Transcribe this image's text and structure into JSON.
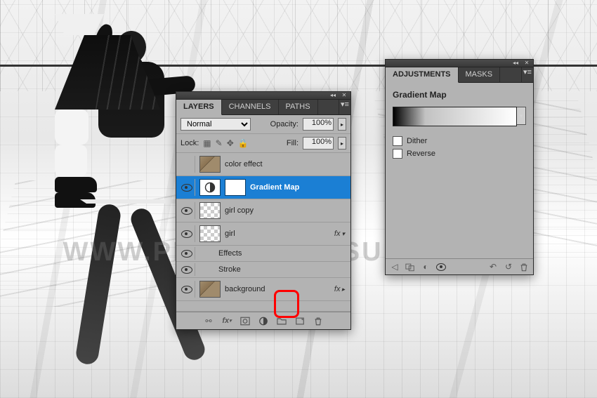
{
  "watermark": "WWW.PHOTOSHOPSUPPLY.COM",
  "layersPanel": {
    "tabs": [
      "LAYERS",
      "CHANNELS",
      "PATHS"
    ],
    "activeTab": 0,
    "blendMode": "Normal",
    "opacityLabel": "Opacity:",
    "opacityValue": "100%",
    "lockLabel": "Lock:",
    "fillLabel": "Fill:",
    "fillValue": "100%",
    "layers": [
      {
        "name": "color effect",
        "visible": false,
        "type": "image",
        "selected": false,
        "hasFx": false
      },
      {
        "name": "Gradient Map",
        "visible": true,
        "type": "adjustment",
        "selected": true,
        "hasMask": true,
        "hasFx": false
      },
      {
        "name": "girl copy",
        "visible": true,
        "type": "checker",
        "selected": false,
        "hasFx": false
      },
      {
        "name": "girl",
        "visible": true,
        "type": "checker",
        "selected": false,
        "hasFx": true
      },
      {
        "name": "background",
        "visible": true,
        "type": "image",
        "selected": false,
        "hasFx": true
      }
    ],
    "effectsLabel": "Effects",
    "strokeLabel": "Stroke",
    "footerIcons": [
      "link-icon",
      "fx-icon",
      "mask-icon",
      "adjustment-icon",
      "group-icon",
      "new-layer-icon",
      "trash-icon"
    ]
  },
  "adjPanel": {
    "tabs": [
      "ADJUSTMENTS",
      "MASKS"
    ],
    "activeTab": 0,
    "title": "Gradient Map",
    "ditherLabel": "Dither",
    "reverseLabel": "Reverse",
    "ditherChecked": false,
    "reverseChecked": false,
    "footerIcons": [
      "back-icon",
      "presets-icon",
      "clip-icon",
      "visibility-icon",
      "previous-icon",
      "reset-icon",
      "trash-icon"
    ]
  }
}
